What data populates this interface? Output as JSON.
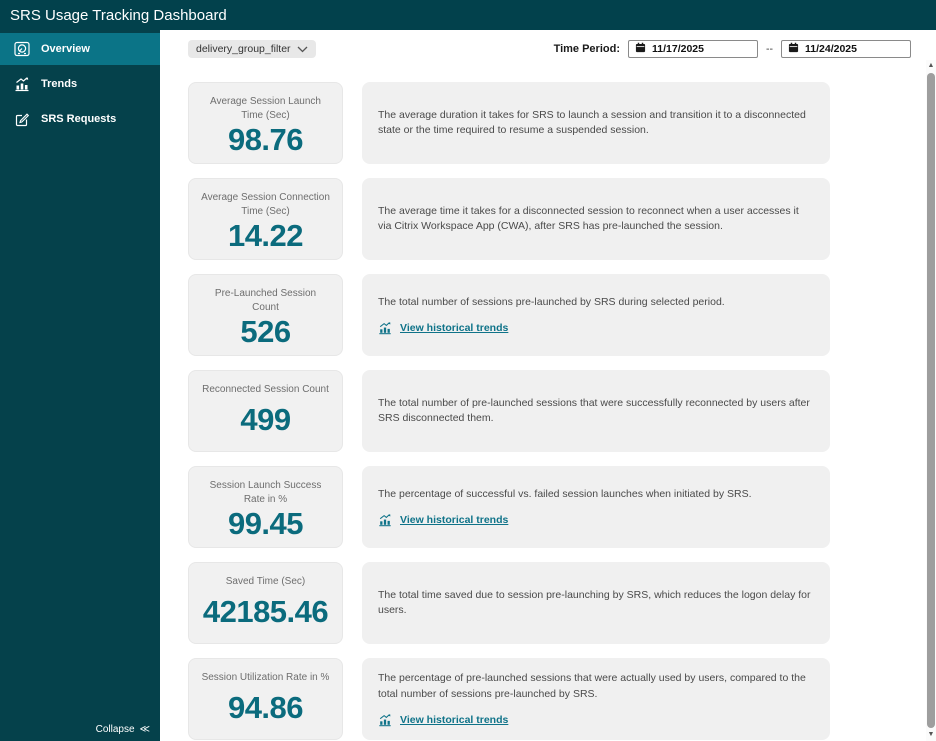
{
  "header": {
    "title": "SRS Usage Tracking Dashboard"
  },
  "sidebar": {
    "items": [
      {
        "label": "Overview",
        "icon": "gauge-icon",
        "selected": true
      },
      {
        "label": "Trends",
        "icon": "trends-chart-icon",
        "selected": false
      },
      {
        "label": "SRS Requests",
        "icon": "edit-icon",
        "selected": false
      }
    ],
    "collapse_label": "Collapse",
    "collapse_glyph": "≪"
  },
  "toolbar": {
    "filter": {
      "label": "delivery_group_filter"
    },
    "time_period": {
      "label": "Time Period:",
      "start": "11/17/2025",
      "separator": "--",
      "end": "11/24/2025"
    }
  },
  "metrics": [
    {
      "title": "Average Session Launch Time (Sec)",
      "value": "98.76",
      "description": "The average duration it takes for SRS to launch a session and transition it to a disconnected state or the time required to resume a suspended session.",
      "link": null
    },
    {
      "title": "Average Session Connection Time (Sec)",
      "value": "14.22",
      "description": "The average time it takes for a disconnected session to reconnect when a user accesses it via Citrix Workspace App (CWA), after SRS has pre-launched the session.",
      "link": null
    },
    {
      "title": "Pre-Launched Session Count",
      "value": "526",
      "description": "The total number of sessions pre-launched by SRS during selected period.",
      "link": "View historical trends"
    },
    {
      "title": "Reconnected Session Count",
      "value": "499",
      "description": "The total number of pre-launched sessions that were successfully reconnected by users after SRS disconnected them.",
      "link": null
    },
    {
      "title": "Session Launch Success Rate in %",
      "value": "99.45",
      "description": "The percentage of successful vs. failed session launches when initiated by SRS.",
      "link": "View historical trends"
    },
    {
      "title": "Saved Time (Sec)",
      "value": "42185.46",
      "description": "The total time saved due to session pre-launching by SRS, which reduces the logon delay for users.",
      "link": null
    },
    {
      "title": "Session Utilization Rate in %",
      "value": "94.86",
      "description": "The percentage of pre-launched sessions that were actually used by users, compared to the total number of sessions pre-launched by SRS.",
      "link": "View historical trends"
    }
  ],
  "colors": {
    "header_bg": "#02414c",
    "sidebar_bg": "#05414b",
    "selected_item_bg": "#0b7487",
    "metric_value": "#0b6b7d",
    "link": "#0f7389",
    "card_bg": "#f0f0f0"
  }
}
